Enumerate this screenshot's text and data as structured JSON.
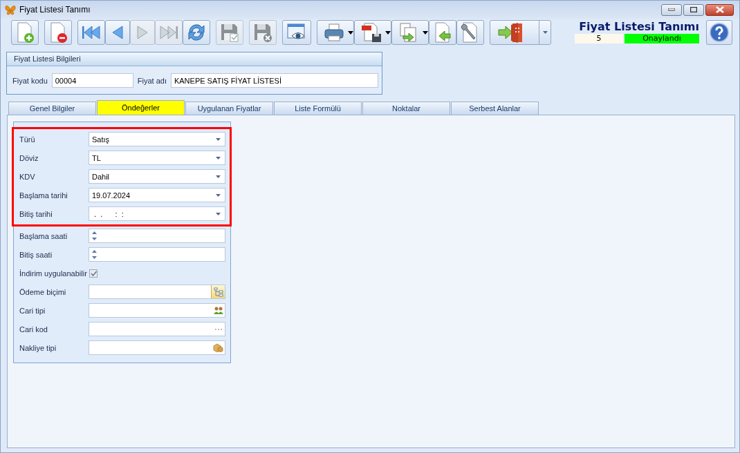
{
  "window": {
    "title": "Fiyat Listesi Tanımı"
  },
  "toolbar": [
    [
      {
        "kind": "new",
        "disabled": false,
        "dropdown": false
      }
    ],
    [
      {
        "kind": "delete",
        "disabled": false,
        "dropdown": false
      }
    ],
    [
      {
        "kind": "first",
        "disabled": false,
        "dropdown": false
      },
      {
        "kind": "prev",
        "disabled": false,
        "dropdown": false
      },
      {
        "kind": "next",
        "disabled": true,
        "dropdown": false
      },
      {
        "kind": "last",
        "disabled": true,
        "dropdown": false
      },
      {
        "kind": "refresh",
        "disabled": false,
        "dropdown": false
      }
    ],
    [
      {
        "kind": "save",
        "disabled": true,
        "dropdown": false
      }
    ],
    [
      {
        "kind": "cancel",
        "disabled": true,
        "dropdown": false
      }
    ],
    [
      {
        "kind": "preview",
        "disabled": false,
        "dropdown": false
      }
    ],
    [
      {
        "kind": "print",
        "disabled": false,
        "dropdown": true
      },
      {
        "kind": "pdf",
        "disabled": false,
        "dropdown": true
      },
      {
        "kind": "export",
        "disabled": false,
        "dropdown": true
      },
      {
        "kind": "import",
        "disabled": false,
        "dropdown": false
      },
      {
        "kind": "tools",
        "disabled": false,
        "dropdown": false
      }
    ],
    [
      {
        "kind": "exit",
        "disabled": false,
        "dropdown": true
      }
    ]
  ],
  "header": {
    "title": "Fiyat Listesi Tanımı",
    "number": "5",
    "status": "Onaylandı"
  },
  "info_panel": {
    "title": "Fiyat Listesi Bilgileri",
    "fields": [
      {
        "label": "Fiyat kodu",
        "value": "00004"
      },
      {
        "label": "Fiyat adı",
        "value": "KANEPE SATIŞ FİYAT LİSTESİ"
      }
    ]
  },
  "tabs": [
    {
      "label": "Genel Bilgiler",
      "selected": false
    },
    {
      "label": "Öndeğerler",
      "selected": true
    },
    {
      "label": "Uygulanan Fiyatlar",
      "selected": false
    },
    {
      "label": "Liste Formülü",
      "selected": false
    },
    {
      "label": "Noktalar",
      "selected": false
    },
    {
      "label": "Serbest Alanlar",
      "selected": false
    }
  ],
  "highlighted_fields": [
    {
      "label": "Türü",
      "kind": "dropdown",
      "value": "Satış"
    },
    {
      "label": "Döviz",
      "kind": "dropdown",
      "value": "TL"
    },
    {
      "label": "KDV",
      "kind": "dropdown",
      "value": "Dahil"
    },
    {
      "label": "Başlama tarihi",
      "kind": "dropdown",
      "value": "19.07.2024"
    },
    {
      "label": "Bitiş tarihi",
      "kind": "dropdown",
      "value": " .  .      :  :"
    }
  ],
  "fields": [
    {
      "label": "Başlama saati",
      "kind": "spin"
    },
    {
      "label": "Bitiş saati",
      "kind": "spin"
    },
    {
      "label": "İndirim uygulanabilir",
      "kind": "checkbox",
      "checked": true
    },
    {
      "label": "Ödeme biçimi",
      "kind": "tree"
    },
    {
      "label": "Cari tipi",
      "kind": "people"
    },
    {
      "label": "Cari kod",
      "kind": "ellipsis"
    },
    {
      "label": "Nakliye tipi",
      "kind": "boxes"
    }
  ]
}
